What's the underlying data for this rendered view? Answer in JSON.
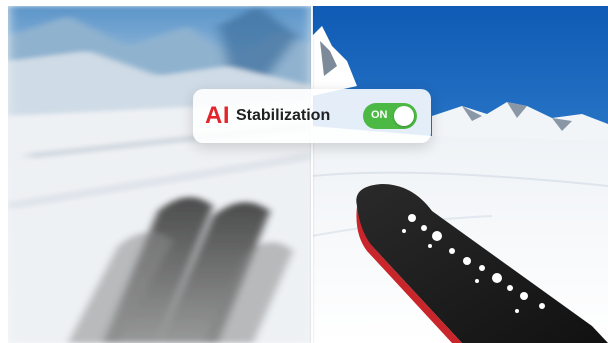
{
  "stabilization_card": {
    "badge": "AI",
    "label": "Stabilization",
    "toggle": {
      "text": "ON",
      "state": "on",
      "color": "#4cb944"
    },
    "badge_color": "#e3262d"
  },
  "panels": {
    "left": "blurred-unstabilized-ski-view",
    "right": "sharp-stabilized-ski-view"
  }
}
